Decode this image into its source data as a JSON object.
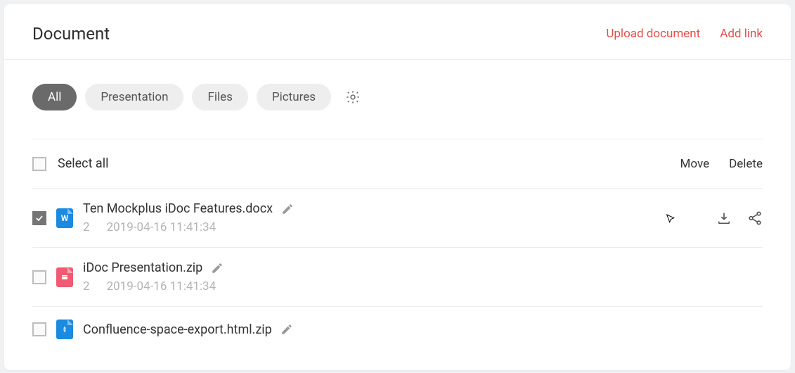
{
  "title": "Document",
  "header_actions": {
    "upload": "Upload document",
    "addlink": "Add link"
  },
  "tabs": {
    "all": "All",
    "presentation": "Presentation",
    "files": "Files",
    "pictures": "Pictures"
  },
  "toolbar": {
    "select_all": "Select all",
    "move": "Move",
    "delete": "Delete"
  },
  "rows": [
    {
      "name": "Ten Mockplus iDoc Features.docx",
      "count": "2",
      "date": "2019-04-16 11:41:34"
    },
    {
      "name": "iDoc Presentation.zip",
      "count": "2",
      "date": "2019-04-16 11:41:34"
    },
    {
      "name": "Confluence-space-export.html.zip"
    }
  ]
}
